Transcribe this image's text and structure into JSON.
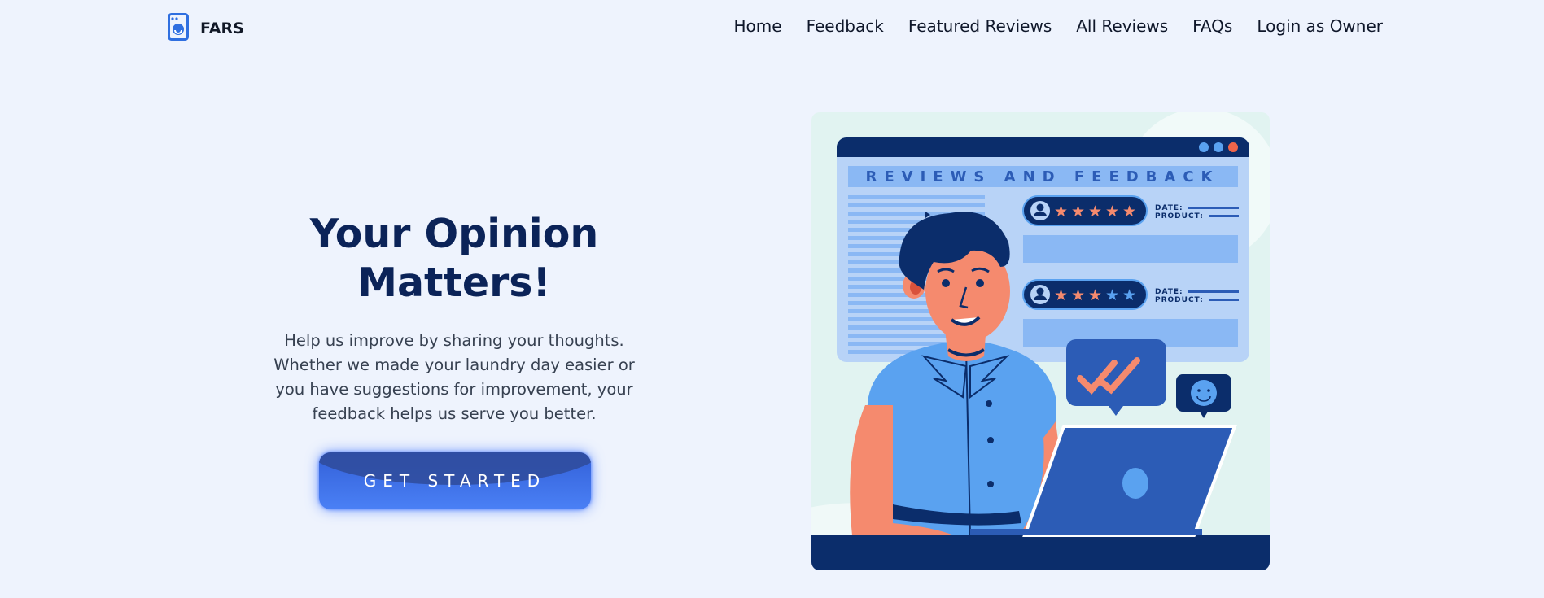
{
  "brand": {
    "name": "FARS",
    "icon": "washing-machine-icon",
    "accent": "#2f6fe0"
  },
  "nav": {
    "items": [
      {
        "label": "Home"
      },
      {
        "label": "Feedback"
      },
      {
        "label": "Featured Reviews"
      },
      {
        "label": "All Reviews"
      },
      {
        "label": "FAQs"
      },
      {
        "label": "Login as Owner"
      }
    ]
  },
  "hero": {
    "title_line1": "Your Opinion",
    "title_line2": "Matters!",
    "subtitle_lines": [
      "Help us improve by sharing your thoughts.",
      "Whether we made your laundry day easier or",
      "you have suggestions for improvement, your",
      "feedback helps us serve you better."
    ],
    "cta_label": "GET STARTED"
  },
  "illustration": {
    "banner": "REVIEWS AND FEEDBACK",
    "date_label": "DATE:",
    "product_label": "PRODUCT:",
    "rating_1_stars": 5,
    "rating_2_stars": 3,
    "colors": {
      "navy": "#0b2d6b",
      "blue": "#5aa2f0",
      "skin": "#f58a6e",
      "laptop": "#2c5cb6"
    }
  }
}
